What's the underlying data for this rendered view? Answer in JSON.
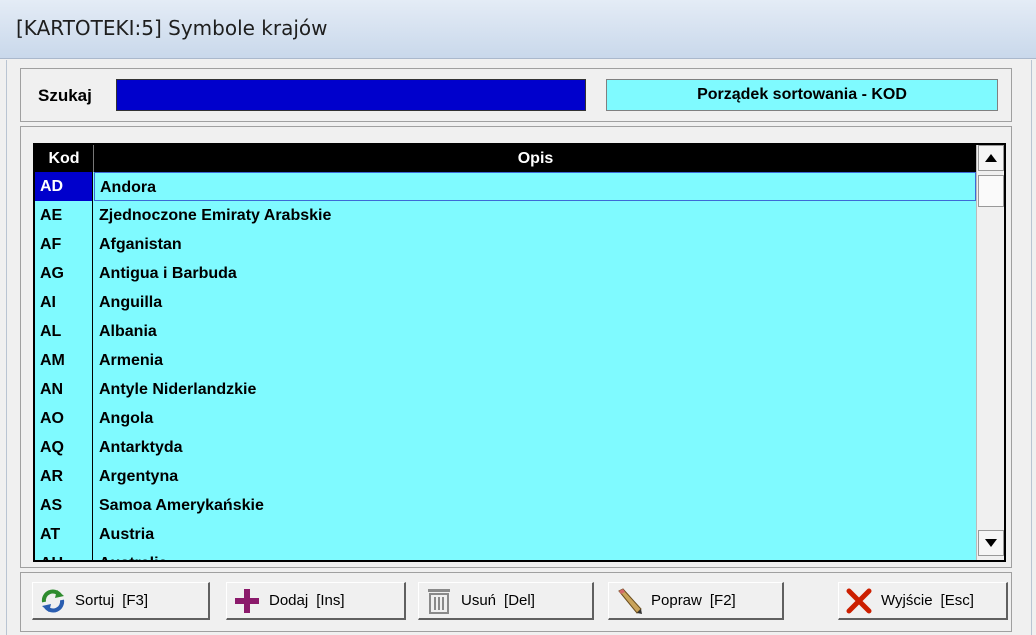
{
  "window": {
    "title": "[KARTOTEKI:5]  Symbole krajów"
  },
  "search": {
    "label": "Szukaj",
    "value": "",
    "sort_order": "Porządek sortowania - KOD"
  },
  "grid": {
    "columns": [
      "Kod",
      "Opis"
    ],
    "rows": [
      {
        "kod": "AD",
        "opis": "Andora"
      },
      {
        "kod": "AE",
        "opis": "Zjednoczone Emiraty Arabskie"
      },
      {
        "kod": "AF",
        "opis": "Afganistan"
      },
      {
        "kod": "AG",
        "opis": "Antigua i Barbuda"
      },
      {
        "kod": "AI",
        "opis": "Anguilla"
      },
      {
        "kod": "AL",
        "opis": "Albania"
      },
      {
        "kod": "AM",
        "opis": "Armenia"
      },
      {
        "kod": "AN",
        "opis": "Antyle Niderlandzkie"
      },
      {
        "kod": "AO",
        "opis": "Angola"
      },
      {
        "kod": "AQ",
        "opis": "Antarktyda"
      },
      {
        "kod": "AR",
        "opis": "Argentyna"
      },
      {
        "kod": "AS",
        "opis": "Samoa Amerykańskie"
      },
      {
        "kod": "AT",
        "opis": "Austria"
      },
      {
        "kod": "AU",
        "opis": "Australia"
      }
    ],
    "selected_index": 0
  },
  "toolbar": {
    "sort": {
      "label": "Sortuj",
      "key": "[F3]",
      "icon": "refresh-arrows-icon"
    },
    "add": {
      "label": "Dodaj",
      "key": "[Ins]",
      "icon": "plus-icon"
    },
    "delete": {
      "label": "Usuń",
      "key": "[Del]",
      "icon": "trash-icon"
    },
    "edit": {
      "label": "Popraw",
      "key": "[F2]",
      "icon": "pencil-icon"
    },
    "exit": {
      "label": "Wyjście",
      "key": "[Esc]",
      "icon": "close-x-icon"
    }
  },
  "colors": {
    "grid_bg": "#7ffaff",
    "search_bg": "#0000cc",
    "header_bg": "#000000",
    "add_icon": "#8b1a6b",
    "exit_icon": "#cc1f00"
  }
}
